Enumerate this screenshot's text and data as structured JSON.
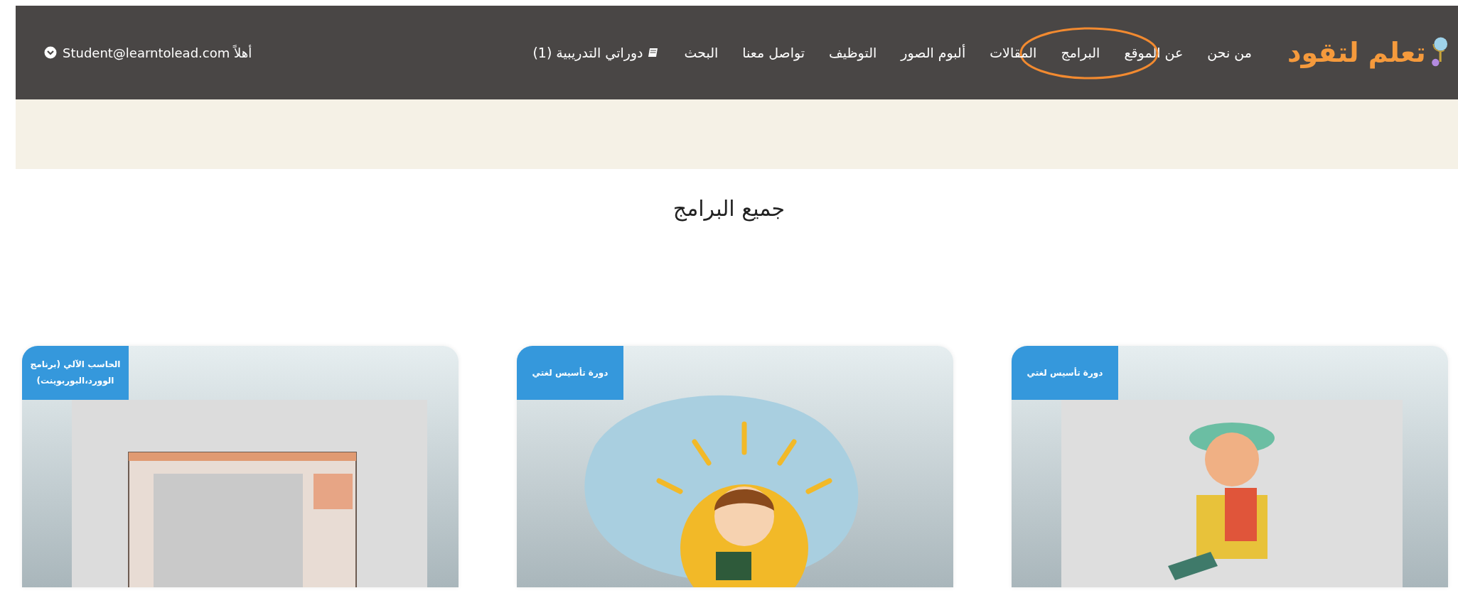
{
  "header": {
    "logo_text": "تعلم لتقود",
    "nav": [
      {
        "label": "من نحن",
        "kind": "link"
      },
      {
        "label": "عن الموقع",
        "kind": "link"
      },
      {
        "label": "البرامج",
        "kind": "link",
        "highlighted": true
      },
      {
        "label": "المقالات",
        "kind": "link"
      },
      {
        "label": "ألبوم الصور",
        "kind": "link"
      },
      {
        "label": "التوظيف",
        "kind": "link"
      },
      {
        "label": "تواصل معنا",
        "kind": "link"
      },
      {
        "label": "البحث",
        "kind": "link"
      },
      {
        "label": "دوراتي التدريبية (1)",
        "kind": "courses"
      }
    ],
    "user": "أهلاً Student@learntolead.com"
  },
  "page_title": "جميع البرامج",
  "cards": [
    {
      "badge": "دورة تأسيس لغتي",
      "kind": "child"
    },
    {
      "badge": "دورة تأسيس لغتي",
      "kind": "sun"
    },
    {
      "badge": "الحاسب الآلي (برنامج الوورد،البوربوينت)",
      "kind": "window"
    }
  ]
}
